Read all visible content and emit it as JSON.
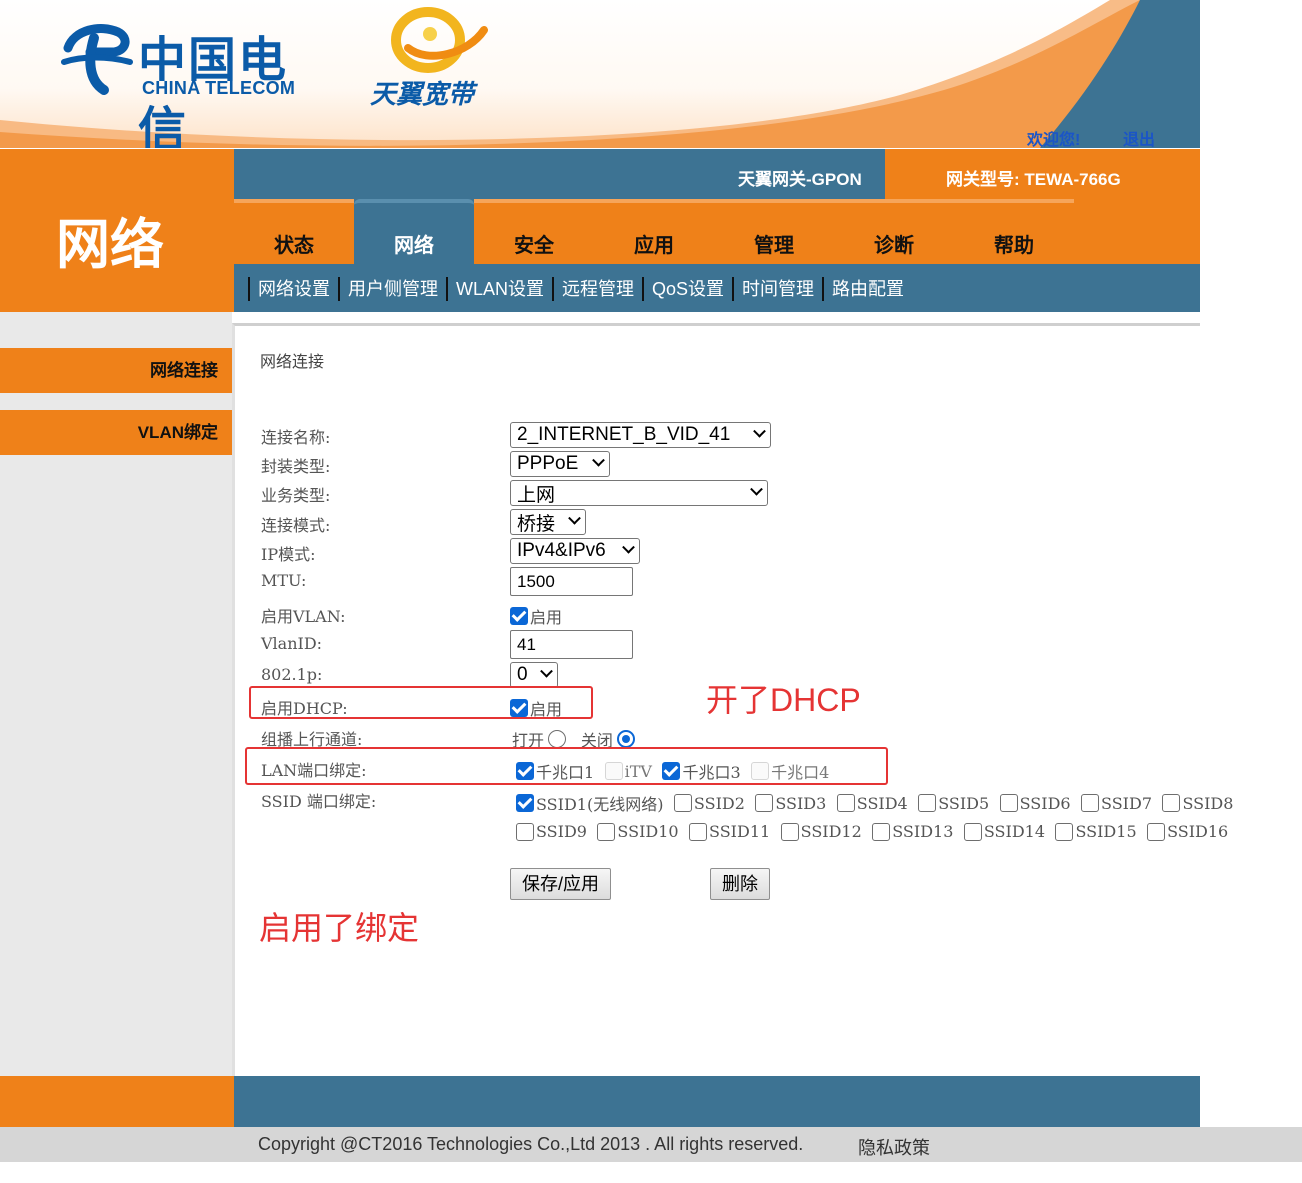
{
  "header": {
    "brand_cn": "中国电信",
    "brand_en": "CHINA TELECOM",
    "product_logo": "天翼宽带",
    "welcome": "欢迎您!",
    "logout": "退出",
    "gateway": "天翼网关-GPON",
    "model": "网关型号: TEWA-766G"
  },
  "section_title": "网络",
  "tabs": [
    {
      "label": "状态"
    },
    {
      "label": "网络"
    },
    {
      "label": "安全"
    },
    {
      "label": "应用"
    },
    {
      "label": "管理"
    },
    {
      "label": "诊断"
    },
    {
      "label": "帮助"
    }
  ],
  "active_tab": "网络",
  "subtabs": [
    "网络设置",
    "用户侧管理",
    "WLAN设置",
    "远程管理",
    "QoS设置",
    "时间管理",
    "路由配置"
  ],
  "sidebar": [
    "网络连接",
    "VLAN绑定"
  ],
  "content_title": "网络连接",
  "form": {
    "conn_name": {
      "label": "连接名称:",
      "value": "2_INTERNET_B_VID_41"
    },
    "encap": {
      "label": "封装类型:",
      "value": "PPPoE"
    },
    "service": {
      "label": "业务类型:",
      "value": "上网"
    },
    "conn_mode": {
      "label": "连接模式:",
      "value": "桥接"
    },
    "ip_mode": {
      "label": "IP模式:",
      "value": "IPv4&IPv6"
    },
    "mtu": {
      "label": "MTU:",
      "value": "1500"
    },
    "vlan_enable": {
      "label": "启用VLAN:",
      "option": "启用",
      "checked": true
    },
    "vlan_id": {
      "label": "VlanID:",
      "value": "41"
    },
    "dot1p": {
      "label": "802.1p:",
      "value": "0"
    },
    "dhcp": {
      "label": "启用DHCP:",
      "option": "启用",
      "checked": true
    },
    "multicast": {
      "label": "组播上行通道:",
      "open": "打开",
      "close": "关闭",
      "selected": "关闭"
    },
    "lan_bind": {
      "label": "LAN端口绑定:",
      "ports": [
        {
          "name": "千兆口1",
          "checked": true,
          "disabled": false
        },
        {
          "name": "iTV",
          "checked": false,
          "disabled": true
        },
        {
          "name": "千兆口3",
          "checked": true,
          "disabled": false
        },
        {
          "name": "千兆口4",
          "checked": false,
          "disabled": true
        }
      ]
    },
    "ssid_bind": {
      "label": "SSID 端口绑定:",
      "row1": [
        {
          "name": "SSID1(无线网络)",
          "checked": true
        },
        {
          "name": "SSID2",
          "checked": false
        },
        {
          "name": "SSID3",
          "checked": false
        },
        {
          "name": "SSID4",
          "checked": false
        },
        {
          "name": "SSID5",
          "checked": false
        },
        {
          "name": "SSID6",
          "checked": false
        },
        {
          "name": "SSID7",
          "checked": false
        },
        {
          "name": "SSID8",
          "checked": false
        }
      ],
      "row2": [
        {
          "name": "SSID9",
          "checked": false
        },
        {
          "name": "SSID10",
          "checked": false
        },
        {
          "name": "SSID11",
          "checked": false
        },
        {
          "name": "SSID12",
          "checked": false
        },
        {
          "name": "SSID13",
          "checked": false
        },
        {
          "name": "SSID14",
          "checked": false
        },
        {
          "name": "SSID15",
          "checked": false
        },
        {
          "name": "SSID16",
          "checked": false
        }
      ]
    },
    "save_button": "保存/应用",
    "delete_button": "删除"
  },
  "annotations": {
    "dhcp_note": "开了DHCP",
    "bind_note": "启用了绑定",
    "color": "#e53434"
  },
  "footer": {
    "copyright": "Copyright @CT2016 Technologies Co.,Ltd 2013 . All rights reserved.",
    "privacy": "隐私政策"
  },
  "colors": {
    "orange": "#ef8119",
    "blue": "#3d7393",
    "link": "#1b55c7"
  }
}
